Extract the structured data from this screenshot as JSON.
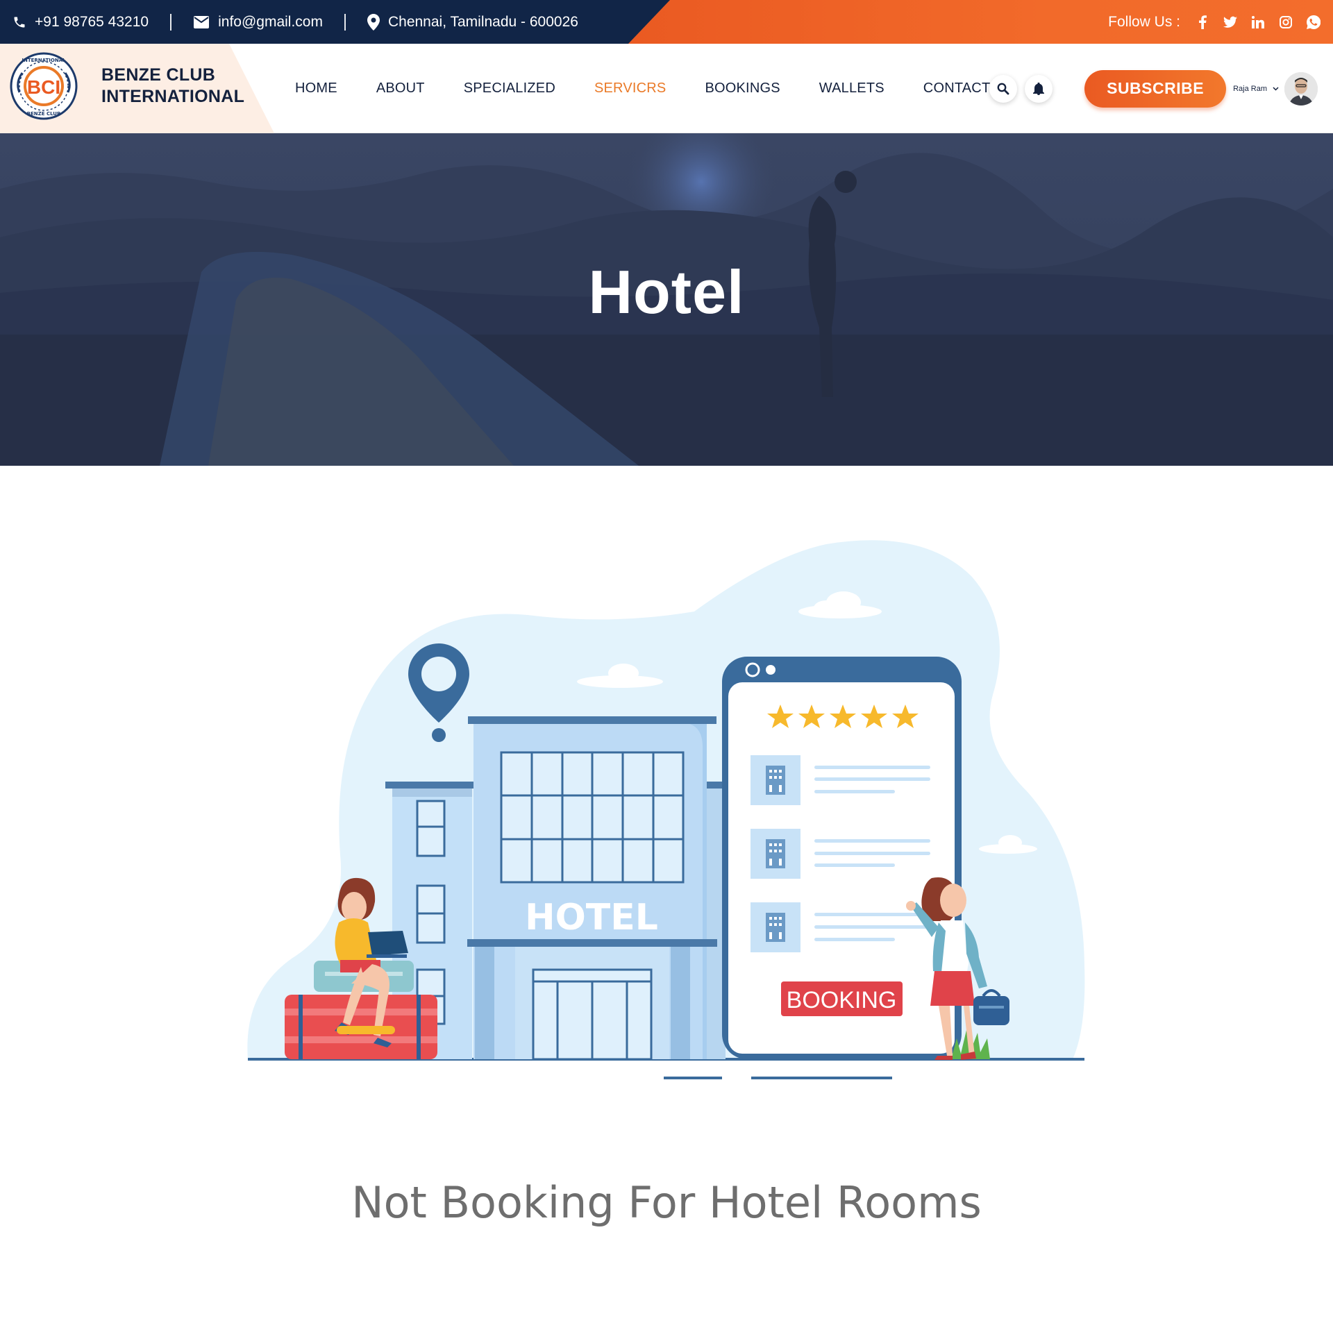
{
  "topbar": {
    "phone": "+91 98765 43210",
    "email": "info@gmail.com",
    "address": "Chennai, Tamilnadu - 600026",
    "follow_label": "Follow Us :",
    "social_icons": [
      "facebook-icon",
      "twitter-icon",
      "linkedin-icon",
      "instagram-icon",
      "whatsapp-icon"
    ]
  },
  "header": {
    "brand_line1": "BENZE CLUB",
    "brand_line2": "INTERNATIONAL",
    "logo_text": "BCI",
    "logo_ring_top": "INTERNATIONAL",
    "logo_ring_bottom": "BENZE CLUB",
    "nav": {
      "home": "HOME",
      "about": "ABOUT",
      "specialized": "SPECIALIZED",
      "services": "SERVICRS",
      "bookings": "BOOKINGS",
      "wallets": "WALLETS",
      "contact": "CONTACT"
    },
    "active_nav": "SERVICRS",
    "subscribe_label": "SUBSCRIBE",
    "user_name": "Raja Ram"
  },
  "hero": {
    "title": "Hotel"
  },
  "illustration": {
    "building_sign": "HOTEL",
    "booking_label": "BOOKING",
    "rating_stars": 5
  },
  "message": "Not Booking For Hotel Rooms",
  "colors": {
    "navy": "#112547",
    "orange": "#ea5a22",
    "active_nav": "#ea7a28",
    "hero_overlay": "#2c3652",
    "message_gray": "#6e6e6e",
    "booking_red": "#e0434a"
  }
}
